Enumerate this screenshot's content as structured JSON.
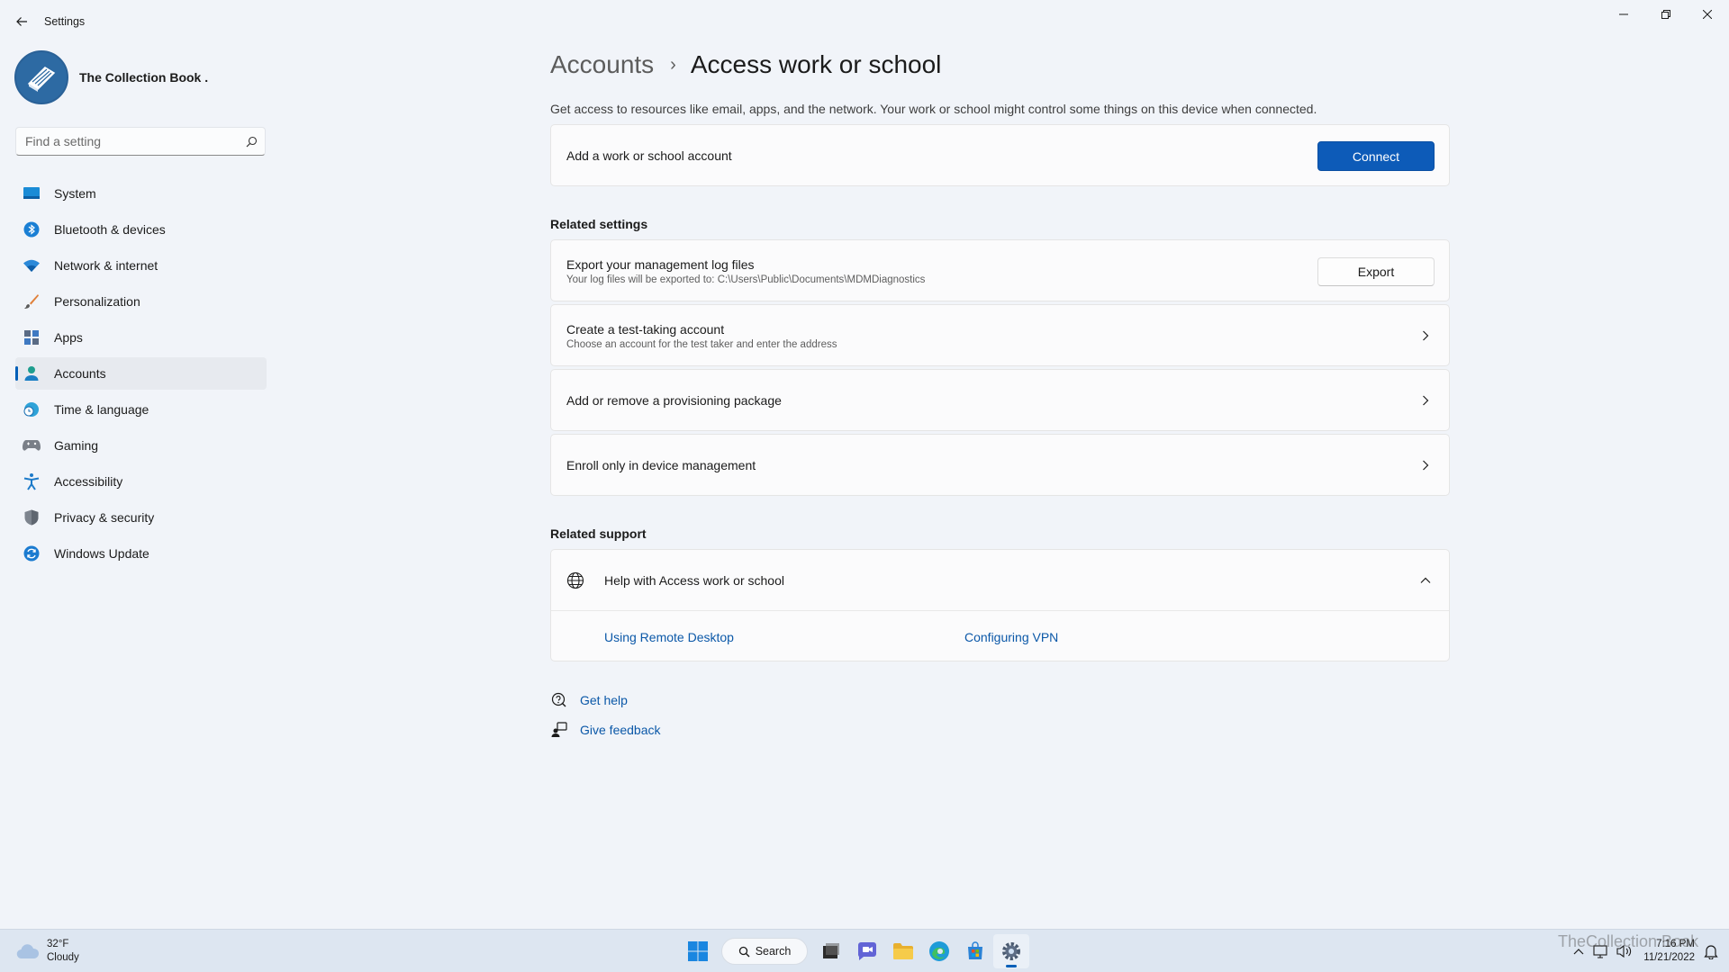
{
  "window": {
    "title": "Settings",
    "controls": [
      "minimize-icon",
      "restore-icon",
      "close-icon"
    ]
  },
  "profile": {
    "name": "The Collection Book ."
  },
  "search": {
    "placeholder": "Find a setting",
    "value": ""
  },
  "sidebar": {
    "items": [
      {
        "label": "System",
        "icon": "system-icon"
      },
      {
        "label": "Bluetooth & devices",
        "icon": "bluetooth-icon"
      },
      {
        "label": "Network & internet",
        "icon": "wifi-icon"
      },
      {
        "label": "Personalization",
        "icon": "brush-icon"
      },
      {
        "label": "Apps",
        "icon": "apps-icon"
      },
      {
        "label": "Accounts",
        "icon": "person-icon",
        "active": true
      },
      {
        "label": "Time & language",
        "icon": "globe-clock-icon"
      },
      {
        "label": "Gaming",
        "icon": "gamepad-icon"
      },
      {
        "label": "Accessibility",
        "icon": "accessibility-icon"
      },
      {
        "label": "Privacy & security",
        "icon": "shield-icon"
      },
      {
        "label": "Windows Update",
        "icon": "update-icon"
      }
    ]
  },
  "breadcrumb": {
    "parent": "Accounts",
    "separator": "›",
    "current": "Access work or school"
  },
  "description": "Get access to resources like email, apps, and the network. Your work or school might control some things on this device when connected.",
  "add_account": {
    "title": "Add a work or school account",
    "button": "Connect"
  },
  "related_settings": {
    "heading": "Related settings",
    "export": {
      "title": "Export your management log files",
      "subtitle": "Your log files will be exported to: C:\\Users\\Public\\Documents\\MDMDiagnostics",
      "button": "Export"
    },
    "test_account": {
      "title": "Create a test-taking account",
      "subtitle": "Choose an account for the test taker and enter the address"
    },
    "provisioning": {
      "title": "Add or remove a provisioning package"
    },
    "enroll": {
      "title": "Enroll only in device management"
    }
  },
  "related_support": {
    "heading": "Related support",
    "help_title": "Help with Access work or school",
    "links": [
      "Using Remote Desktop",
      "Configuring VPN"
    ]
  },
  "footer": {
    "get_help": "Get help",
    "give_feedback": "Give feedback"
  },
  "taskbar": {
    "weather": {
      "temp": "32°F",
      "condition": "Cloudy"
    },
    "search_label": "Search",
    "apps": [
      "start-icon",
      "search-icon",
      "task-view-icon",
      "chat-icon",
      "file-explorer-icon",
      "edge-icon",
      "store-icon",
      "settings-icon"
    ],
    "clock": {
      "time": "7:16 PM",
      "date": "11/21/2022"
    },
    "watermark": "TheCollection Book"
  },
  "colors": {
    "accent": "#005fb8",
    "background": "#f1f4f9",
    "card": "#fbfbfc",
    "link": "#0b58a8"
  }
}
